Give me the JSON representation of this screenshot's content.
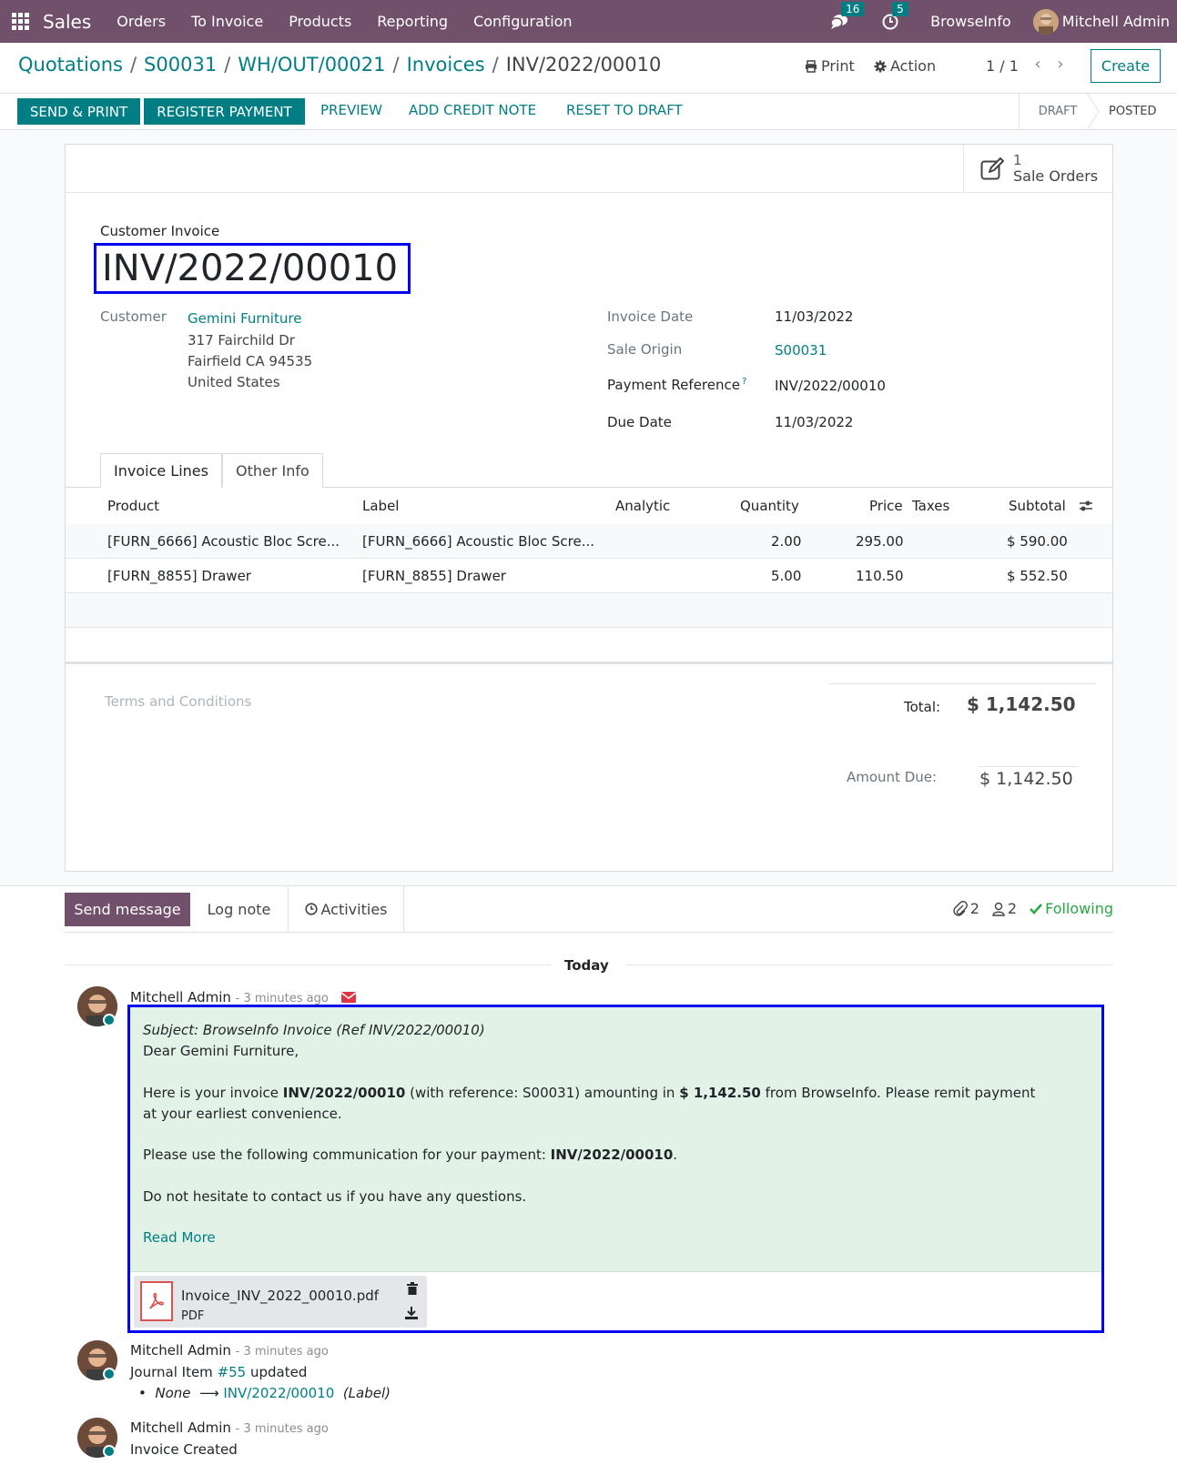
{
  "navbar": {
    "app_name": "Sales",
    "menu": [
      "Orders",
      "To Invoice",
      "Products",
      "Reporting",
      "Configuration"
    ],
    "messages_count": "16",
    "activities_count": "5",
    "company": "BrowseInfo",
    "user": "Mitchell Admin",
    "bg_color": "#71506b"
  },
  "breadcrumb": {
    "items": [
      "Quotations",
      "S00031",
      "WH/OUT/00021",
      "Invoices"
    ],
    "current": "INV/2022/00010"
  },
  "control": {
    "print": "Print",
    "action": "Action",
    "pager": "1 / 1",
    "create": "Create"
  },
  "statusbar": {
    "buttons": [
      "SEND & PRINT",
      "REGISTER PAYMENT"
    ],
    "links": [
      "PREVIEW",
      "ADD CREDIT NOTE",
      "RESET TO DRAFT"
    ],
    "states": [
      "DRAFT",
      "POSTED"
    ],
    "active_state": "POSTED"
  },
  "smart_button": {
    "count": "1",
    "label": "Sale Orders"
  },
  "invoice": {
    "type": "Customer Invoice",
    "name": "INV/2022/00010",
    "customer_label": "Customer",
    "customer_name": "Gemini Furniture",
    "address": [
      "317 Fairchild Dr",
      "Fairfield CA 94535",
      "United States"
    ],
    "invoice_date_label": "Invoice Date",
    "invoice_date": "11/03/2022",
    "sale_origin_label": "Sale Origin",
    "sale_origin": "S00031",
    "payment_ref_label": "Payment Reference",
    "payment_ref_help": "?",
    "payment_ref": "INV/2022/00010",
    "due_date_label": "Due Date",
    "due_date": "11/03/2022"
  },
  "tabs": [
    "Invoice Lines",
    "Other Info"
  ],
  "lines": {
    "columns": [
      "Product",
      "Label",
      "Analytic",
      "Quantity",
      "Price",
      "Taxes",
      "Subtotal"
    ],
    "rows": [
      {
        "product": "[FURN_6666] Acoustic Bloc Scre...",
        "label": "[FURN_6666] Acoustic Bloc Scre...",
        "quantity": "2.00",
        "price": "295.00",
        "subtotal": "$ 590.00"
      },
      {
        "product": "[FURN_8855] Drawer",
        "label": "[FURN_8855] Drawer",
        "quantity": "5.00",
        "price": "110.50",
        "subtotal": "$ 552.50"
      }
    ]
  },
  "footer": {
    "terms_placeholder": "Terms and Conditions",
    "total_label": "Total:",
    "total": "$ 1,142.50",
    "amount_due_label": "Amount Due:",
    "amount_due": "$ 1,142.50"
  },
  "chatter": {
    "send_message": "Send message",
    "log_note": "Log note",
    "activities": "Activities",
    "attachments_count": "2",
    "followers_count": "2",
    "following": "Following",
    "today": "Today",
    "messages": [
      {
        "author": "Mitchell Admin",
        "time": "- 3 minutes ago",
        "subject": "Subject: BrowseInfo Invoice (Ref INV/2022/00010)",
        "greeting": "Dear Gemini Furniture,",
        "p1_a": "Here is your invoice ",
        "p1_b": "INV/2022/00010",
        "p1_c": " (with reference: S00031) amounting in ",
        "p1_d": "$ 1,142.50",
        "p1_e": " from BrowseInfo. Please remit payment",
        "p1_f": "at your earliest convenience.",
        "p2_a": "Please use the following communication for your payment: ",
        "p2_b": "INV/2022/00010",
        "p2_c": ".",
        "p3": "Do not hesitate to contact us if you have any questions.",
        "read_more": "Read More",
        "attachment_name": "Invoice_INV_2022_00010.pdf",
        "attachment_type": "PDF"
      },
      {
        "author": "Mitchell Admin",
        "time": "- 3 minutes ago",
        "text_a": "Journal Item ",
        "text_link": "#55",
        "text_b": " updated",
        "change_old": "None",
        "change_new": "INV/2022/00010",
        "change_field": "(Label)"
      },
      {
        "author": "Mitchell Admin",
        "time": "- 3 minutes ago",
        "text": "Invoice Created"
      }
    ]
  }
}
